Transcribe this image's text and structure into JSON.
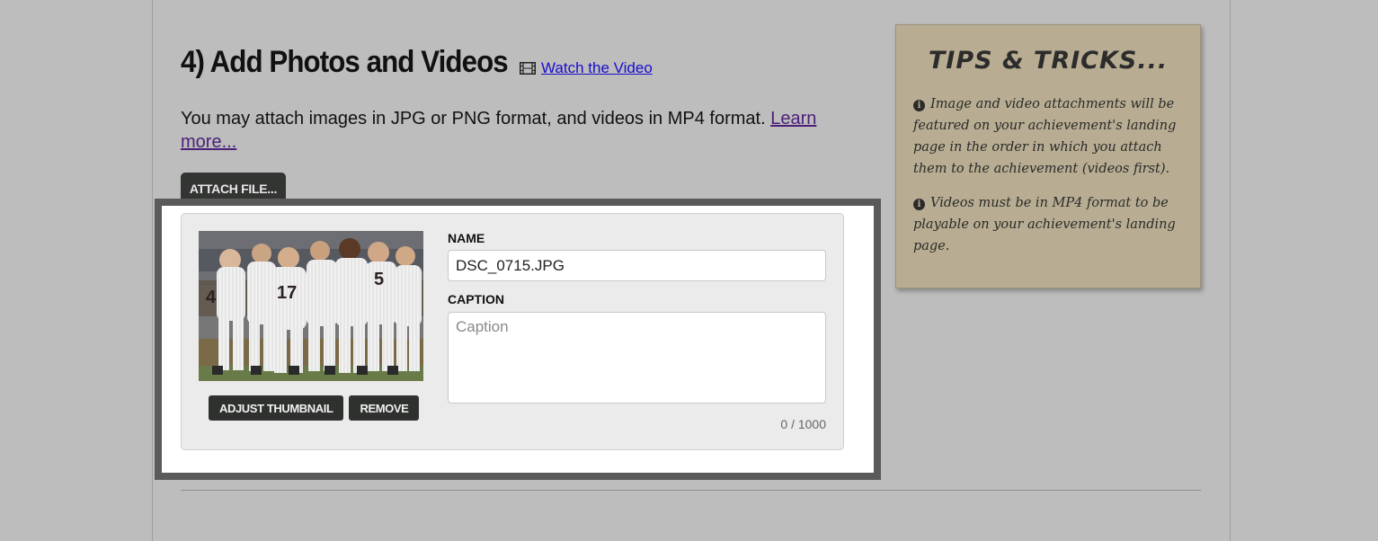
{
  "section": {
    "title": "4) Add Photos and Videos",
    "video_link": "Watch the Video",
    "intro_text": "You may attach images in JPG or PNG format, and videos in MP4 format.",
    "learn_more": "Learn more..."
  },
  "attach": {
    "button_label": "ATTACH FILE..."
  },
  "attachment": {
    "name_label": "NAME",
    "name_value": "DSC_0715.JPG",
    "caption_label": "CAPTION",
    "caption_placeholder": "Caption",
    "caption_value": "",
    "char_count": "0 / 1000",
    "adjust_thumbnail_label": "ADJUST THUMBNAIL",
    "remove_label": "REMOVE"
  },
  "tips": {
    "title": "TIPS & TRICKS...",
    "items": [
      "Image and video attachments will be featured on your achievement's landing page in the order in which you attach them to the achievement (videos first).",
      "Videos must be in MP4 format to be playable on your achievement's landing page."
    ]
  },
  "icons": {
    "video": "film-icon",
    "info": "info-circle-icon"
  },
  "colors": {
    "background": "#bdbdbd",
    "tips_background": "#b8ad92",
    "dark_button": "#333533",
    "panel_border": "#5a5a5a",
    "link": "#1a0dcc",
    "visited_link": "#4b1f7a"
  }
}
